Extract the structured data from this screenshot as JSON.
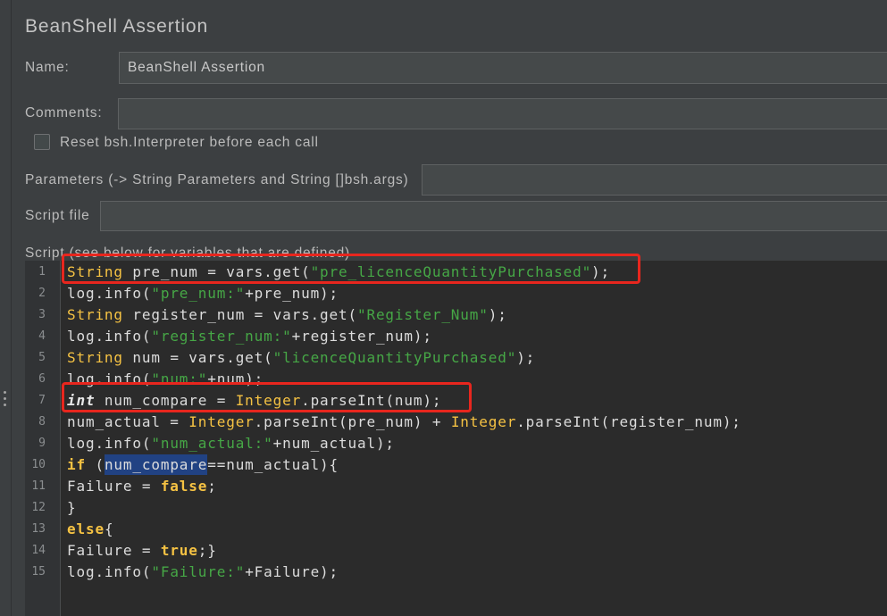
{
  "window": {
    "title": "BeanShell Assertion"
  },
  "form": {
    "name": {
      "label": "Name:",
      "value": "BeanShell Assertion"
    },
    "comments": {
      "label": "Comments:",
      "value": ""
    },
    "reset_interpreter": {
      "label": "Reset bsh.Interpreter before each call",
      "checked": false
    },
    "parameters": {
      "label": "Parameters (-> String Parameters and String []bsh.args)",
      "value": ""
    },
    "script_file": {
      "label": "Script file",
      "value": ""
    },
    "script": {
      "label": "Script (see below for variables that are defined)"
    }
  },
  "editor": {
    "lines": [
      {
        "n": "1",
        "tokens": [
          {
            "k": "type",
            "v": "String"
          },
          {
            "k": "plain",
            "v": " pre_num = vars.get("
          },
          {
            "k": "string",
            "v": "\"pre_licenceQuantityPurchased\""
          },
          {
            "k": "plain",
            "v": ");"
          }
        ]
      },
      {
        "n": "2",
        "tokens": [
          {
            "k": "plain",
            "v": "log.info("
          },
          {
            "k": "string",
            "v": "\"pre_num:\""
          },
          {
            "k": "plain",
            "v": "+pre_num);"
          }
        ]
      },
      {
        "n": "3",
        "tokens": [
          {
            "k": "type",
            "v": "String"
          },
          {
            "k": "plain",
            "v": " register_num = vars.get("
          },
          {
            "k": "string",
            "v": "\"Register_Num\""
          },
          {
            "k": "plain",
            "v": ");"
          }
        ]
      },
      {
        "n": "4",
        "tokens": [
          {
            "k": "plain",
            "v": "log.info("
          },
          {
            "k": "string",
            "v": "\"register_num:\""
          },
          {
            "k": "plain",
            "v": "+register_num);"
          }
        ]
      },
      {
        "n": "5",
        "tokens": [
          {
            "k": "type",
            "v": "String"
          },
          {
            "k": "plain",
            "v": " num = vars.get("
          },
          {
            "k": "string",
            "v": "\"licenceQuantityPurchased\""
          },
          {
            "k": "plain",
            "v": ");"
          }
        ]
      },
      {
        "n": "6",
        "tokens": [
          {
            "k": "plain",
            "v": "log.info("
          },
          {
            "k": "string",
            "v": "\"num:\""
          },
          {
            "k": "plain",
            "v": "+num);"
          }
        ]
      },
      {
        "n": "7",
        "tokens": [
          {
            "k": "int",
            "v": "int"
          },
          {
            "k": "plain",
            "v": " num_compare = "
          },
          {
            "k": "type",
            "v": "Integer"
          },
          {
            "k": "plain",
            "v": ".parseInt(num);"
          }
        ]
      },
      {
        "n": "8",
        "tokens": [
          {
            "k": "plain",
            "v": "num_actual = "
          },
          {
            "k": "type",
            "v": "Integer"
          },
          {
            "k": "plain",
            "v": ".parseInt(pre_num) + "
          },
          {
            "k": "type",
            "v": "Integer"
          },
          {
            "k": "plain",
            "v": ".parseInt(register_num);"
          }
        ]
      },
      {
        "n": "9",
        "tokens": [
          {
            "k": "plain",
            "v": "log.info("
          },
          {
            "k": "string",
            "v": "\"num_actual:\""
          },
          {
            "k": "plain",
            "v": "+num_actual);"
          }
        ]
      },
      {
        "n": "10",
        "tokens": [
          {
            "k": "keyword",
            "v": "if"
          },
          {
            "k": "plain",
            "v": " ("
          },
          {
            "k": "sel",
            "v": "num_compare"
          },
          {
            "k": "plain",
            "v": "==num_actual){"
          }
        ]
      },
      {
        "n": "11",
        "tokens": [
          {
            "k": "plain",
            "v": "Failure = "
          },
          {
            "k": "keyword",
            "v": "false"
          },
          {
            "k": "plain",
            "v": ";"
          }
        ]
      },
      {
        "n": "12",
        "tokens": [
          {
            "k": "plain",
            "v": "}"
          }
        ]
      },
      {
        "n": "13",
        "tokens": [
          {
            "k": "keyword",
            "v": "else"
          },
          {
            "k": "plain",
            "v": "{"
          }
        ]
      },
      {
        "n": "14",
        "tokens": [
          {
            "k": "plain",
            "v": "Failure = "
          },
          {
            "k": "keyword",
            "v": "true"
          },
          {
            "k": "plain",
            "v": ";}"
          }
        ]
      },
      {
        "n": "15",
        "tokens": [
          {
            "k": "plain",
            "v": "log.info("
          },
          {
            "k": "string",
            "v": "\"Failure:\""
          },
          {
            "k": "plain",
            "v": "+Failure);"
          }
        ]
      }
    ]
  },
  "annotations": {
    "highlight_lines": [
      1,
      7
    ]
  },
  "icons": {
    "splitter_handle": "vertical-dots-icon"
  },
  "colors": {
    "panel_bg": "#3c3f41",
    "text": "#bbbbbb",
    "field_bg": "#45494a",
    "field_border": "#5e6162",
    "editor_bg": "#2b2b2b",
    "gutter_bg": "#313335",
    "line_number": "#8a8d8f",
    "code_plain": "#dcdcdc",
    "code_type": "#f5c243",
    "code_keyword": "#f5c243",
    "code_string": "#46a746",
    "code_int": "#e8e8e8",
    "selection_bg": "#214283",
    "highlight_red": "#e8261e"
  }
}
